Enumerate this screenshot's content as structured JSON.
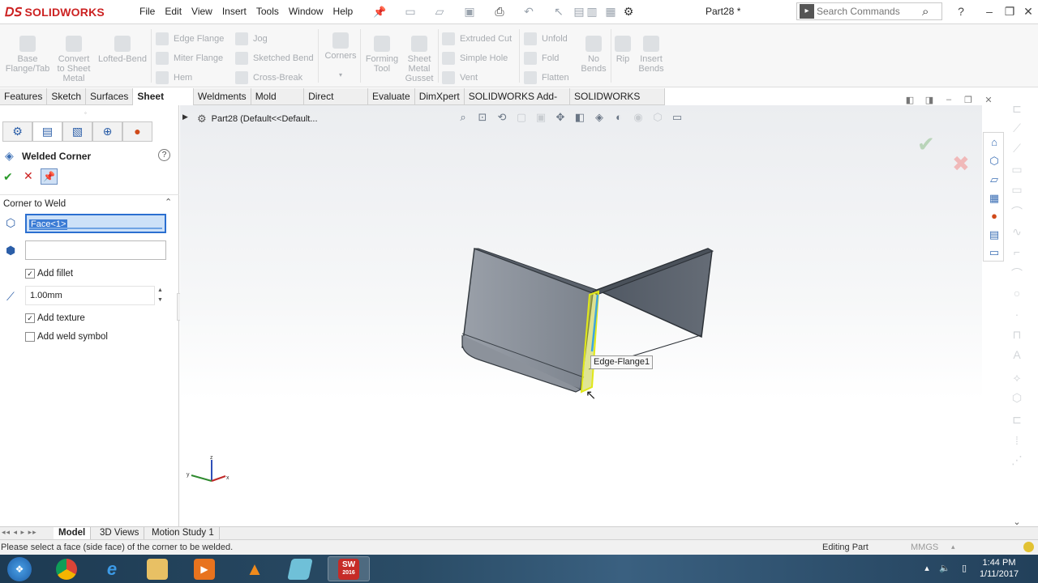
{
  "app": {
    "brand": "SOLIDWORKS",
    "doc_title": "Part28 *"
  },
  "menu": [
    "File",
    "Edit",
    "View",
    "Insert",
    "Tools",
    "Window",
    "Help"
  ],
  "search": {
    "placeholder": "Search Commands"
  },
  "ribbon": {
    "large": [
      {
        "label": "Base\nFlange/Tab"
      },
      {
        "label": "Convert\nto Sheet\nMetal"
      },
      {
        "label": "Lofted-Bend"
      },
      {
        "label": "Corners"
      },
      {
        "label": "Forming\nTool"
      },
      {
        "label": "Sheet\nMetal\nGusset"
      },
      {
        "label": "No\nBends"
      },
      {
        "label": "Rip"
      },
      {
        "label": "Insert\nBends"
      }
    ],
    "small": {
      "col1": [
        "Edge Flange",
        "Miter Flange",
        "Hem"
      ],
      "col2": [
        "Jog",
        "Sketched Bend",
        "Cross-Break"
      ],
      "col3": [
        "Extruded Cut",
        "Simple Hole",
        "Vent"
      ],
      "col4": [
        "Unfold",
        "Fold",
        "Flatten"
      ]
    }
  },
  "tabs": [
    "Features",
    "Sketch",
    "Surfaces",
    "Sheet Metal",
    "Weldments",
    "Mold Tools",
    "Direct Editing",
    "Evaluate",
    "DimXpert",
    "SOLIDWORKS Add-Ins",
    "SOLIDWORKS MBD"
  ],
  "active_tab": "Sheet Metal",
  "property_manager": {
    "title": "Welded Corner",
    "section": "Corner to Weld",
    "face_selection": "Face<1>",
    "add_fillet_label": "Add fillet",
    "add_fillet": true,
    "radius": "1.00mm",
    "add_texture_label": "Add texture",
    "add_texture": true,
    "add_weld_symbol_label": "Add weld symbol",
    "add_weld_symbol": false
  },
  "viewport": {
    "tree_label": "Part28  (Default<<Default...",
    "tooltip": "Edge-Flange1"
  },
  "bottom_tabs": [
    "Model",
    "3D Views",
    "Motion Study 1"
  ],
  "status": {
    "message": "Please select a face (side face) of the corner to be welded.",
    "mode": "Editing Part",
    "units": "MMGS"
  },
  "taskbar": {
    "time": "1:44 PM",
    "date": "1/11/2017",
    "sw_badge": "2016"
  },
  "colors": {
    "accent": "#cc2222",
    "selection": "#3a7bd5",
    "highlight_edge": "#d9e21a"
  }
}
